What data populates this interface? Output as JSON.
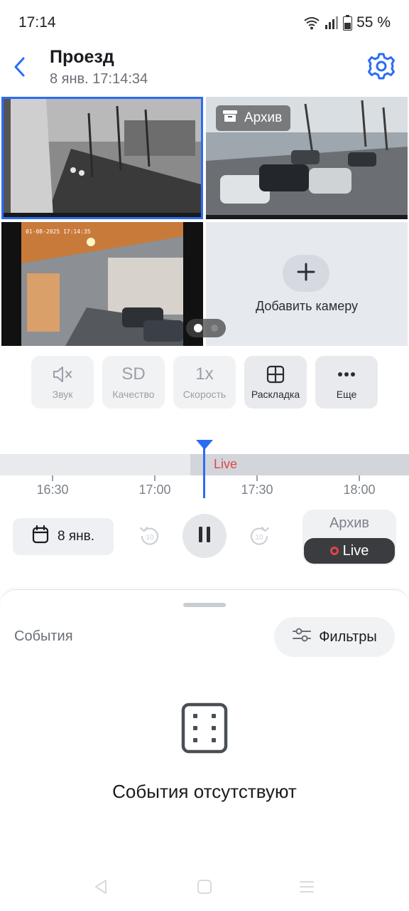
{
  "status_bar": {
    "time": "17:14",
    "battery": "55 %",
    "icons": [
      "wifi-icon",
      "signal-icon",
      "battery-icon"
    ]
  },
  "header": {
    "title": "Проезд",
    "subtitle": "8 янв. 17:14:34",
    "icons": [
      "back-arrow-icon",
      "settings-gear-icon"
    ]
  },
  "grid": {
    "archive_badge": "Архив",
    "cam3_stamp": "01-08-2025 17:14:35",
    "add_camera_label": "Добавить камеру",
    "pages": 2,
    "current_page": 1
  },
  "controls": [
    {
      "icon": "speaker-muted-icon",
      "label": "Звук",
      "active": false
    },
    {
      "icon_text": "SD",
      "label": "Качество",
      "active": false
    },
    {
      "icon_text": "1x",
      "label": "Скорость",
      "active": false
    },
    {
      "icon": "layout-grid-icon",
      "label": "Раскладка",
      "active": true
    },
    {
      "icon": "more-dots-icon",
      "label": "Еще",
      "active": true
    }
  ],
  "timeline": {
    "live_label": "Live",
    "ticks": [
      "16:30",
      "17:00",
      "17:30",
      "18:00"
    ]
  },
  "playback": {
    "date_label": "8 янв.",
    "rewind_seconds": "10",
    "forward_seconds": "10",
    "mode_archive": "Архив",
    "mode_live": "Live",
    "selected_mode": "Live"
  },
  "events": {
    "title": "События",
    "filters_label": "Фильтры",
    "empty_text": "События отсутствуют"
  },
  "colors": {
    "accent": "#2b6cf5",
    "live_red": "#e0454a"
  }
}
